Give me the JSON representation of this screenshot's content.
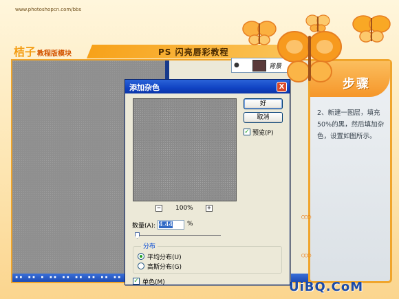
{
  "site": {
    "url": "www.photoshopcn.com/bbs",
    "logo_main": "桔子",
    "logo_sub": "教程版模块",
    "tutorial_title": "PS 闪亮唇彩教程"
  },
  "photoshop": {
    "layer_name": "背景"
  },
  "dialog": {
    "title": "添加杂色",
    "close_label": "X",
    "ok_label": "好",
    "cancel_label": "取消",
    "preview_label": "预览(P)",
    "preview_checked": true,
    "zoom_minus": "−",
    "zoom_plus": "+",
    "zoom_level": "100%",
    "amount_label": "数量(A):",
    "amount_value": "4.44",
    "amount_unit": "%",
    "distribution_title": "分布",
    "dist_uniform": "平均分布(U)",
    "dist_gaussian": "高斯分布(G)",
    "selected_distribution": "uniform",
    "mono_label": "单色(M)",
    "mono_checked": true
  },
  "side": {
    "header": "步骤",
    "step_text": "2、新建一图层，填充50%的黑，然后填加杂色，设置如图所示。"
  },
  "watermark": "UiBQ.CoM",
  "colors": {
    "accent_orange": "#f0a52c",
    "xp_title_blue": "#1143c3",
    "canvas_gray": "#8f8f8f"
  }
}
